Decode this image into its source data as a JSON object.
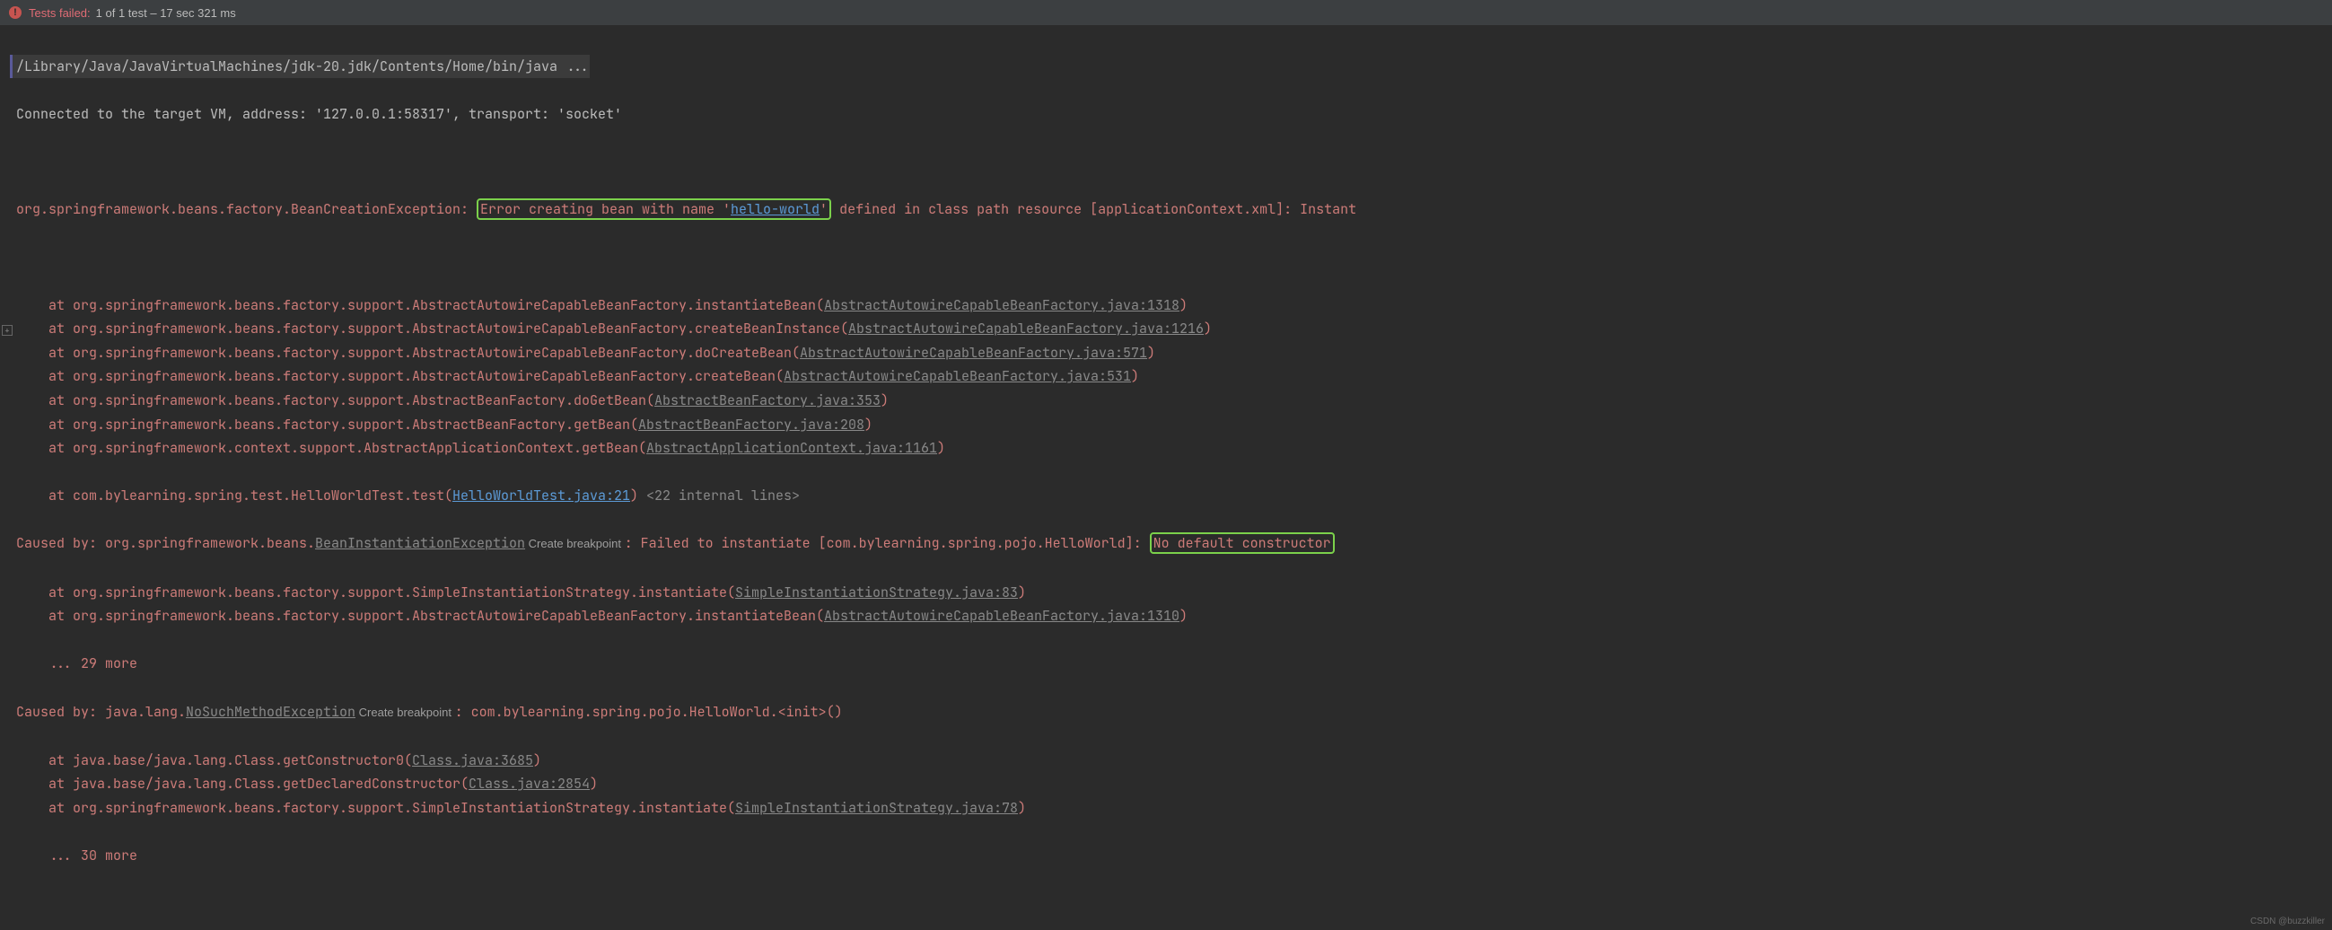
{
  "header": {
    "fail_label": "Tests failed:",
    "fail_count": "1 of 1 test – 17 sec 321 ms"
  },
  "console": {
    "cmd": "/Library/Java/JavaVirtualMachines/jdk-20.jdk/Contents/Home/bin/java ...",
    "connected": "Connected to the target VM, address: '127.0.0.1:58317', transport: 'socket'",
    "exc_prefix": "org.springframework.beans.factory.BeanCreationException: ",
    "exc_box_a": "Error creating bean with name '",
    "exc_box_link": "hello-world",
    "exc_box_b": "'",
    "exc_suffix": " defined in class path resource [applicationContext.xml]: Instant",
    "stack": [
      {
        "t": "    at org.springframework.beans.factory.support.AbstractAutowireCapableBeanFactory.instantiateBean(",
        "l": "AbstractAutowireCapableBeanFactory.java:1318",
        "c": ")"
      },
      {
        "t": "    at org.springframework.beans.factory.support.AbstractAutowireCapableBeanFactory.createBeanInstance(",
        "l": "AbstractAutowireCapableBeanFactory.java:1216",
        "c": ")"
      },
      {
        "t": "    at org.springframework.beans.factory.support.AbstractAutowireCapableBeanFactory.doCreateBean(",
        "l": "AbstractAutowireCapableBeanFactory.java:571",
        "c": ")"
      },
      {
        "t": "    at org.springframework.beans.factory.support.AbstractAutowireCapableBeanFactory.createBean(",
        "l": "AbstractAutowireCapableBeanFactory.java:531",
        "c": ")"
      },
      {
        "t": "    at org.springframework.beans.factory.support.AbstractBeanFactory.doGetBean(",
        "l": "AbstractBeanFactory.java:353",
        "c": ")"
      },
      {
        "t": "    at org.springframework.beans.factory.support.AbstractBeanFactory.getBean(",
        "l": "AbstractBeanFactory.java:208",
        "c": ")"
      },
      {
        "t": "    at org.springframework.context.support.AbstractApplicationContext.getBean(",
        "l": "AbstractApplicationContext.java:1161",
        "c": ")"
      }
    ],
    "user_stack_prefix": "    at com.bylearning.spring.test.HelloWorldTest.test(",
    "user_stack_link": "HelloWorldTest.java:21",
    "user_stack_close": ")",
    "internal_lines": " <22 internal lines>",
    "caused1_a": "Caused by: org.springframework.beans.",
    "caused1_exc": "BeanInstantiationException",
    "caused1_action": " Create breakpoint ",
    "caused1_b": ": Failed to instantiate [com.bylearning.spring.pojo.HelloWorld]: ",
    "caused1_box": "No default constructor",
    "stack2": [
      {
        "t": "    at org.springframework.beans.factory.support.SimpleInstantiationStrategy.instantiate(",
        "l": "SimpleInstantiationStrategy.java:83",
        "c": ")"
      },
      {
        "t": "    at org.springframework.beans.factory.support.AbstractAutowireCapableBeanFactory.instantiateBean(",
        "l": "AbstractAutowireCapableBeanFactory.java:1310",
        "c": ")"
      }
    ],
    "more1": "    ... 29 more",
    "caused2_a": "Caused by: java.lang.",
    "caused2_exc": "NoSuchMethodException",
    "caused2_action": " Create breakpoint ",
    "caused2_b": ": com.bylearning.spring.pojo.HelloWorld.<init>()",
    "stack3": [
      {
        "t": "    at java.base/java.lang.Class.getConstructor0(",
        "l": "Class.java:3685",
        "c": ")"
      },
      {
        "t": "    at java.base/java.lang.Class.getDeclaredConstructor(",
        "l": "Class.java:2854",
        "c": ")"
      },
      {
        "t": "    at org.springframework.beans.factory.support.SimpleInstantiationStrategy.instantiate(",
        "l": "SimpleInstantiationStrategy.java:78",
        "c": ")"
      }
    ],
    "more2": "    ... 30 more"
  },
  "watermark": "CSDN @buzzkiller"
}
